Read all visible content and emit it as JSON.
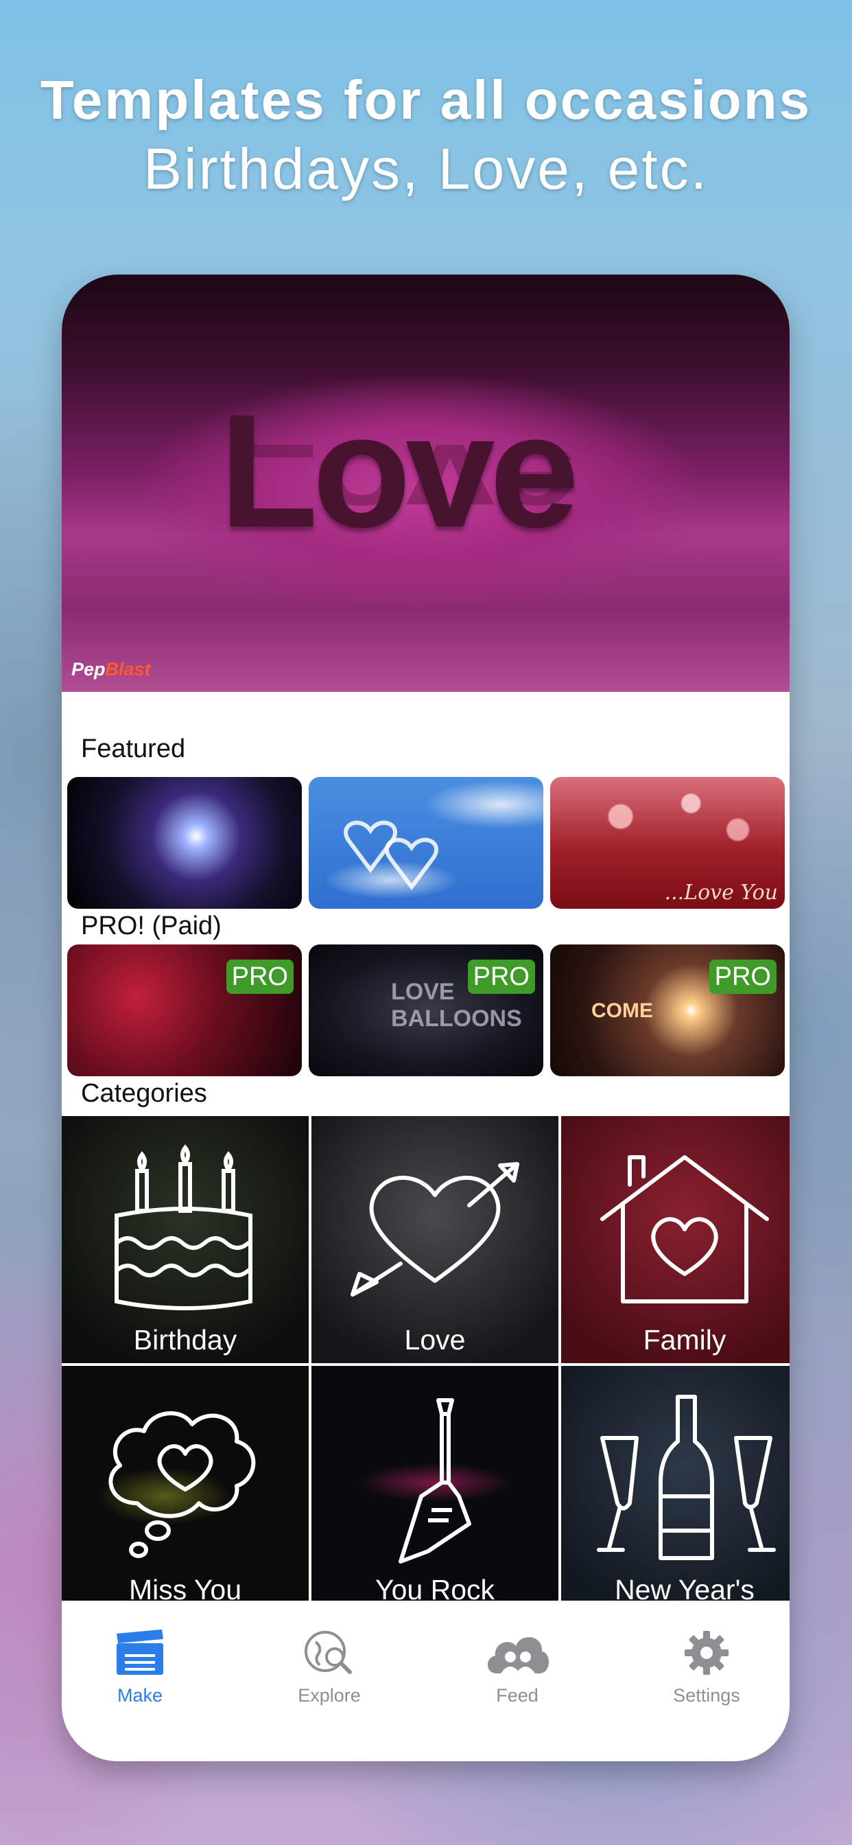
{
  "headline": {
    "title": "Templates for all occasions",
    "subtitle": "Birthdays, Love, etc."
  },
  "hero": {
    "word": "Love",
    "logo_a": "Pep",
    "logo_b": "Blast"
  },
  "featured": {
    "label": "Featured",
    "items": [
      {
        "icon": "light-burst"
      },
      {
        "icon": "cloud-hearts"
      },
      {
        "icon": "bokeh",
        "caption": "...Love You"
      }
    ]
  },
  "pro": {
    "label": "PRO! (Paid)",
    "badge": "PRO",
    "items": [
      {
        "icon": "red-sparkles"
      },
      {
        "icon": "love-balloons",
        "caption": "LOVE BALLOONS"
      },
      {
        "icon": "lens-flare",
        "caption": "COME"
      }
    ]
  },
  "categories": {
    "label": "Categories",
    "items": [
      {
        "label": "Birthday",
        "icon": "cake-icon"
      },
      {
        "label": "Love",
        "icon": "heart-arrow-icon"
      },
      {
        "label": "Family",
        "icon": "house-heart-icon"
      },
      {
        "label": "Miss You",
        "icon": "thought-heart-icon"
      },
      {
        "label": "You Rock",
        "icon": "guitar-icon"
      },
      {
        "label": "New Year's",
        "icon": "champagne-icon"
      }
    ]
  },
  "tabbar": {
    "items": [
      {
        "label": "Make",
        "icon": "clapperboard-icon",
        "active": true
      },
      {
        "label": "Explore",
        "icon": "globe-search-icon",
        "active": false
      },
      {
        "label": "Feed",
        "icon": "cloud-people-icon",
        "active": false
      },
      {
        "label": "Settings",
        "icon": "gear-icon",
        "active": false
      }
    ]
  },
  "colors": {
    "accent": "#2b7de9",
    "pro_badge": "#3f9b28",
    "tab_inactive": "#8e8e93"
  }
}
